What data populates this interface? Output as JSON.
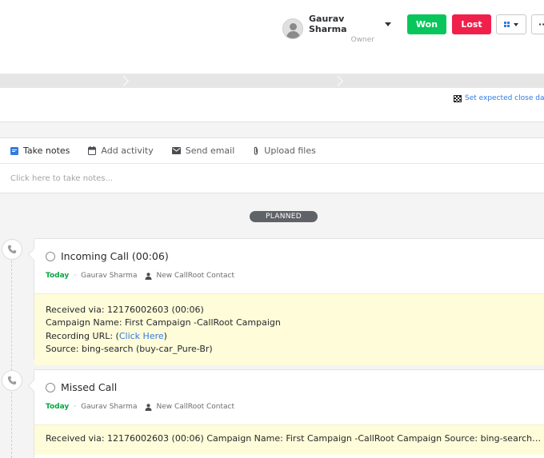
{
  "header": {
    "owner_name": "Gaurav Sharma",
    "owner_role": "Owner",
    "won_label": "Won",
    "lost_label": "Lost",
    "more_label": "···"
  },
  "deal": {
    "close_date_link": "Set expected close date"
  },
  "composer": {
    "tabs": [
      {
        "label": "Take notes",
        "icon": "note-icon"
      },
      {
        "label": "Add activity",
        "icon": "calendar-icon"
      },
      {
        "label": "Send email",
        "icon": "email-icon"
      },
      {
        "label": "Upload files",
        "icon": "paperclip-icon"
      }
    ],
    "placeholder": "Click here to take notes..."
  },
  "feed": {
    "section_label": "PLANNED",
    "activities": [
      {
        "title": "Incoming Call (00:06)",
        "when": "Today",
        "assignee": "Gaurav Sharma",
        "contact": "New CallRoot Contact",
        "lines": {
          "received": "Received via: 12176002603 (00:06)",
          "campaign": "Campaign Name: First Campaign -CallRoot Campaign",
          "recording_prefix": "Recording URL: (",
          "recording_link": "Click Here",
          "recording_suffix": ")",
          "source": "Source: bing-search (buy-car_Pure-Br)"
        }
      },
      {
        "title": "Missed Call",
        "when": "Today",
        "assignee": "Gaurav Sharma",
        "contact": "New CallRoot Contact",
        "summary": "Received via: 12176002603 (00:06) Campaign Name: First Campaign -CallRoot Campaign Source: bing-search (buy-car..."
      }
    ]
  },
  "colors": {
    "won": "#08c65b",
    "lost": "#f0204b",
    "link": "#317ae2",
    "today": "#08a742",
    "note_bg": "#fffcd9"
  }
}
